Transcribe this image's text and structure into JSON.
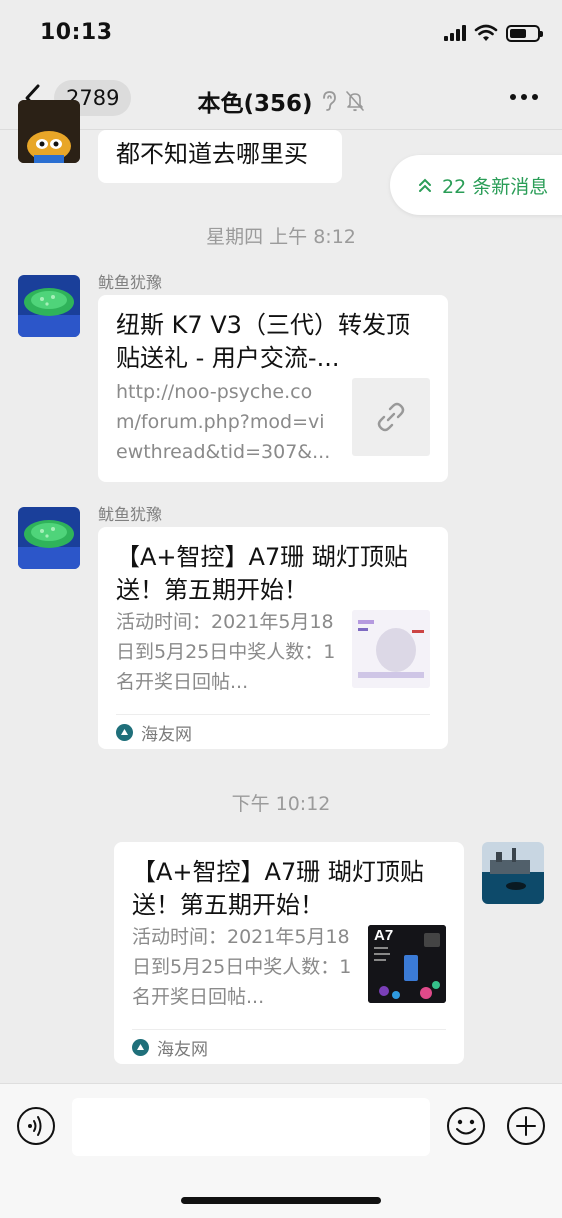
{
  "status_bar": {
    "time": "10:13"
  },
  "nav": {
    "back_count": "2789",
    "title": "本色(356)"
  },
  "new_messages_pill": "22 条新消息",
  "messages": [
    {
      "text": "都不知道去哪里买"
    },
    {
      "timestamp": "星期四 上午 8:12"
    },
    {
      "sender": "鱿鱼犹豫",
      "card_title": "纽斯 K7 V3（三代）转发顶贴送礼 - 用户交流-...",
      "card_desc": "http://noo-psyche.com/forum.php?mod=viewthread&tid=307&..."
    },
    {
      "sender": "鱿鱼犹豫",
      "card_title": "【A+智控】A7珊 瑚灯顶贴送！第五期开始！",
      "card_desc": "活动时间：2021年5月18日到5月25日中奖人数：1名开奖日回帖...",
      "source": "海友网"
    },
    {
      "timestamp": "下午 10:12"
    },
    {
      "card_title": "【A+智控】A7珊 瑚灯顶贴送！第五期开始！",
      "card_desc": "活动时间：2021年5月18日到5月25日中奖人数：1名开奖日回帖...",
      "thumb_text": "A7",
      "source": "海友网"
    }
  ],
  "colors": {
    "background": "#ededed",
    "bubble": "#ffffff",
    "accent_green": "#2a9d57",
    "secondary_text": "#8a8a8a"
  },
  "icons": [
    "back-arrow-icon",
    "ear-icon",
    "mute-bell-icon",
    "more-icon",
    "double-chevron-up-icon",
    "link-icon",
    "voice-icon",
    "emoji-icon",
    "plus-icon"
  ]
}
